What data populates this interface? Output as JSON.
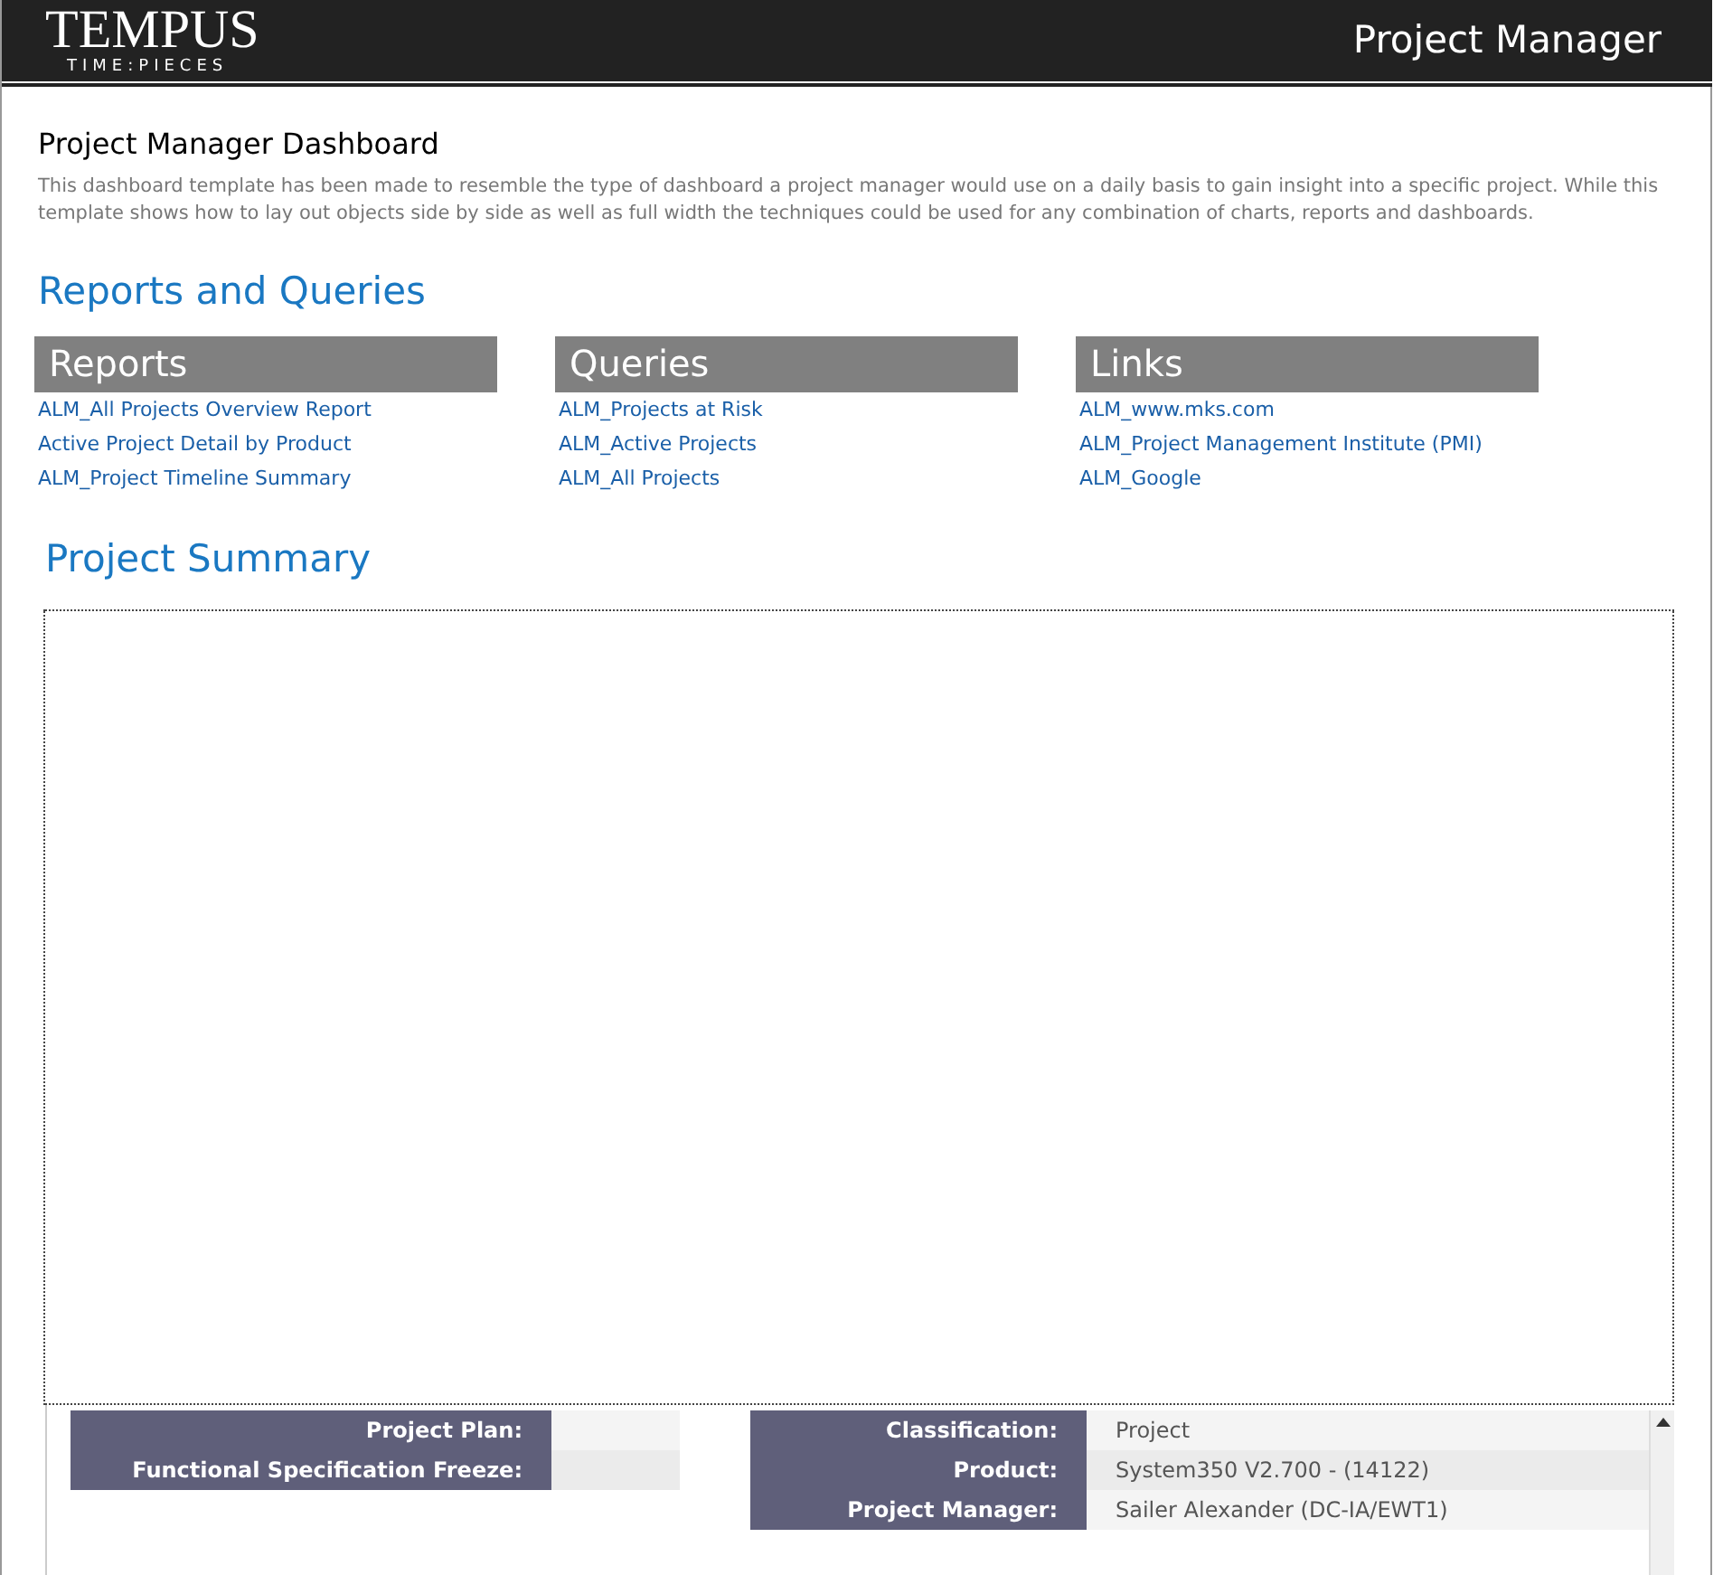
{
  "header": {
    "logo_main": "TEMPUS",
    "logo_sub": "TIME:PIECES",
    "title": "Project Manager"
  },
  "intro": {
    "title": "Project Manager Dashboard",
    "text": "This dashboard template has been made to resemble the type of dashboard a project manager would use on a daily basis to gain insight into a specific project. While this template shows how to lay out objects side by side as well as full width the techniques could be used for any combination of charts, reports and dashboards."
  },
  "reports_heading": "Reports and Queries",
  "columns": [
    {
      "title": "Reports",
      "links": [
        "ALM_All Projects Overview Report",
        "Active Project Detail by Product",
        "ALM_Project Timeline Summary"
      ]
    },
    {
      "title": "Queries",
      "links": [
        "ALM_Projects at Risk",
        "ALM_Active Projects",
        "ALM_All Projects"
      ]
    },
    {
      "title": "Links",
      "links": [
        "ALM_www.mks.com",
        "ALM_Project Management Institute (PMI)",
        "ALM_Google"
      ]
    }
  ],
  "summary_heading": "Project Summary",
  "summary": {
    "left": [
      {
        "label": "Project Plan:"
      },
      {
        "label": "Functional Specification Freeze:"
      }
    ],
    "right": [
      {
        "label": "Classification:",
        "value": "Project"
      },
      {
        "label": "Product:",
        "value": "System350 V2.700 - (14122)"
      },
      {
        "label": "Project Manager:",
        "value": "Sailer Alexander (DC-IA/EWT1)"
      }
    ]
  }
}
